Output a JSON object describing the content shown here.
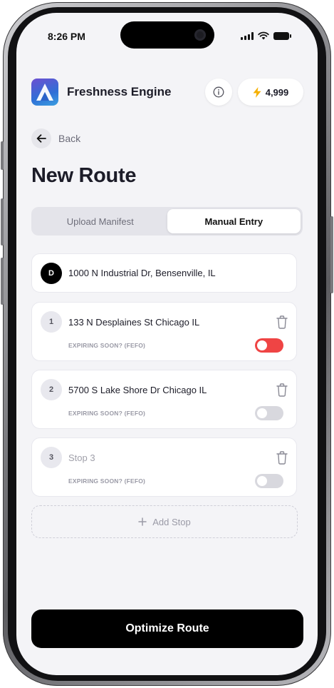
{
  "status_bar": {
    "time": "8:26 PM"
  },
  "header": {
    "app_name": "Freshness Engine",
    "credits": "4,999"
  },
  "nav": {
    "back_label": "Back"
  },
  "page": {
    "title": "New Route"
  },
  "tabs": [
    {
      "label": "Upload Manifest",
      "active": false
    },
    {
      "label": "Manual Entry",
      "active": true
    }
  ],
  "depot": {
    "badge": "D",
    "address": "1000 N Industrial Dr, Bensenville, IL"
  },
  "stops": [
    {
      "number": "1",
      "address": "133 N Desplaines St Chicago IL",
      "placeholder": "",
      "fefo_label": "EXPIRING SOON? (FEFO)",
      "fefo_on": true
    },
    {
      "number": "2",
      "address": "5700 S Lake Shore Dr Chicago IL",
      "placeholder": "",
      "fefo_label": "EXPIRING SOON? (FEFO)",
      "fefo_on": false
    },
    {
      "number": "3",
      "address": "",
      "placeholder": "Stop 3",
      "fefo_label": "EXPIRING SOON? (FEFO)",
      "fefo_on": false
    }
  ],
  "add_stop": {
    "label": "Add Stop"
  },
  "primary_action": {
    "label": "Optimize Route"
  },
  "colors": {
    "toggle_on": "#ef4444",
    "bolt": "#f5b000",
    "primary": "#000000"
  }
}
